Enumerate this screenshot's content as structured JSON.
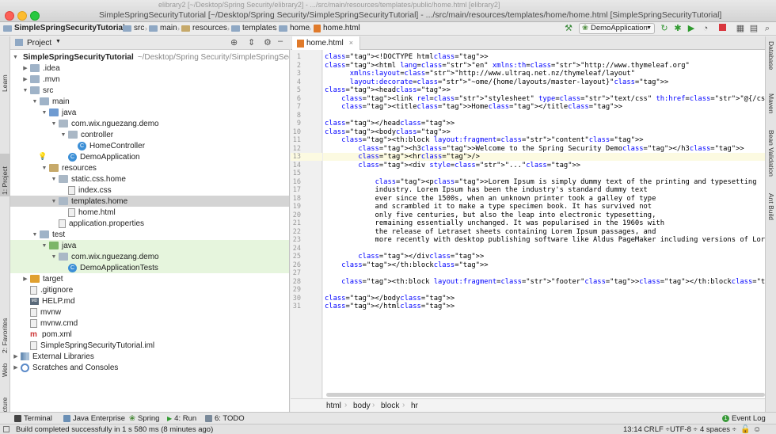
{
  "window": {
    "title": "SimpleSpringSecurityTutorial [~/Desktop/Spring Security/SimpleSpringSecurityTutorial] - .../src/main/resources/templates/home/home.html [SimpleSpringSecurityTutorial]",
    "background_title": "elibrary2 [~/Desktop/Spring Security/elibrary2] - .../src/main/resources/templates/public/home.html [elibrary2]"
  },
  "navbar": {
    "crumbs": [
      "SimpleSpringSecurityTutorial",
      "src",
      "main",
      "resources",
      "templates",
      "home",
      "home.html"
    ],
    "run_config": "DemoApplication"
  },
  "left_stripe": {
    "tabs": [
      "1: Project",
      "Learn",
      "2: Favorites",
      "Web",
      "Z: Structure"
    ]
  },
  "right_stripe": {
    "tabs": [
      "Database",
      "Maven",
      "Bean Validation",
      "Ant Build"
    ]
  },
  "project_panel": {
    "title": "Project",
    "tree": [
      {
        "label": "SimpleSpringSecurityTutorial",
        "path": "~/Desktop/Spring Security/SimpleSpringSec",
        "depth": 0,
        "icon": "folder",
        "expanded": true
      },
      {
        "label": ".idea",
        "depth": 1,
        "icon": "folder",
        "collapsed": true
      },
      {
        "label": ".mvn",
        "depth": 1,
        "icon": "folder",
        "collapsed": true
      },
      {
        "label": "src",
        "depth": 1,
        "icon": "folder",
        "expanded": true
      },
      {
        "label": "main",
        "depth": 2,
        "icon": "folder",
        "expanded": true
      },
      {
        "label": "java",
        "depth": 3,
        "icon": "folder-src",
        "expanded": true
      },
      {
        "label": "com.wix.nguezang.demo",
        "depth": 4,
        "icon": "folder-pkg",
        "expanded": true
      },
      {
        "label": "controller",
        "depth": 5,
        "icon": "folder-pkg",
        "expanded": true
      },
      {
        "label": "HomeController",
        "depth": 6,
        "icon": "class"
      },
      {
        "label": "DemoApplication",
        "depth": 5,
        "icon": "class"
      },
      {
        "label": "resources",
        "depth": 3,
        "icon": "folder-res",
        "expanded": true
      },
      {
        "label": "static.css.home",
        "depth": 4,
        "icon": "folder-pkg",
        "expanded": true
      },
      {
        "label": "index.css",
        "depth": 5,
        "icon": "file"
      },
      {
        "label": "templates.home",
        "depth": 4,
        "icon": "folder-pkg",
        "expanded": true,
        "selected": true
      },
      {
        "label": "home.html",
        "depth": 5,
        "icon": "file"
      },
      {
        "label": "application.properties",
        "depth": 4,
        "icon": "file"
      },
      {
        "label": "test",
        "depth": 2,
        "icon": "folder",
        "expanded": true
      },
      {
        "label": "java",
        "depth": 3,
        "icon": "folder-tst",
        "expanded": true,
        "test": true
      },
      {
        "label": "com.wix.nguezang.demo",
        "depth": 4,
        "icon": "folder-pkg",
        "expanded": true,
        "test": true
      },
      {
        "label": "DemoApplicationTests",
        "depth": 5,
        "icon": "class",
        "test": true
      },
      {
        "label": "target",
        "depth": 1,
        "icon": "folder-tgt",
        "collapsed": true
      },
      {
        "label": ".gitignore",
        "depth": 1,
        "icon": "file"
      },
      {
        "label": "HELP.md",
        "depth": 1,
        "icon": "md"
      },
      {
        "label": "mvnw",
        "depth": 1,
        "icon": "file"
      },
      {
        "label": "mvnw.cmd",
        "depth": 1,
        "icon": "file"
      },
      {
        "label": "pom.xml",
        "depth": 1,
        "icon": "maven"
      },
      {
        "label": "SimpleSpringSecurityTutorial.iml",
        "depth": 1,
        "icon": "file"
      },
      {
        "label": "External Libraries",
        "depth": 0,
        "icon": "library",
        "collapsed": true
      },
      {
        "label": "Scratches and Consoles",
        "depth": 0,
        "icon": "scratch",
        "collapsed": true
      }
    ]
  },
  "editor": {
    "tab": "home.html",
    "current_line": 13,
    "lines": [
      "<!DOCTYPE html>",
      "<html lang=\"en\" xmlns:th=\"http://www.thymeleaf.org\"",
      "      xmlns:layout=\"http://www.ultraq.net.nz/thymeleaf/layout\"",
      "      layout:decorate=\"~ome/{home/layouts/master-layout}\">",
      "<head>",
      "    <link rel=\"stylesheet\" type=\"text/css\" th:href=\"@{/css/home/index.css}\"/>",
      "    <title>Home</title>",
      "",
      "</head>",
      "<body>",
      "    <th:block layout:fragment=\"content\">",
      "        <h3>Welcome to the Spring Security Demo</h3>",
      "        <hr/>",
      "        <div style=\"...\">",
      "",
      "            <p>Lorem Ipsum is simply dummy text of the printing and typesetting",
      "            industry. Lorem Ipsum has been the industry's standard dummy text",
      "            ever since the 1500s, when an unknown printer took a galley of type",
      "            and scrambled it to make a type specimen book. It has survived not",
      "            only five centuries, but also the leap into electronic typesetting,",
      "            remaining essentially unchanged. It was popularised in the 1960s with",
      "            the release of Letraset sheets containing Lorem Ipsum passages, and",
      "            more recently with desktop publishing software like Aldus PageMaker including versions of Lorem Ipsum.",
      "",
      "        </div>",
      "    </th:block>",
      "",
      "    <th:block layout:fragment=\"footer\"></th:block>",
      "",
      "</body>",
      "</html>"
    ],
    "breadcrumbs": [
      "html",
      "body",
      "block",
      "hr"
    ]
  },
  "bottom_tools": [
    "Terminal",
    "Java Enterprise",
    "Spring",
    "4: Run",
    "6: TODO",
    "Event Log"
  ],
  "status": {
    "message": "Build completed successfully in 1 s 580 ms (8 minutes ago)",
    "position": "13:14",
    "line_sep": "CRLF",
    "encoding": "UTF-8",
    "indent": "4 spaces"
  },
  "colors": {
    "selection": "#d4d4d4",
    "test_bg": "#e6f5dd",
    "tag": "#000080",
    "attr": "#0000ff",
    "string": "#008000",
    "current_line": "#fcfae1"
  }
}
